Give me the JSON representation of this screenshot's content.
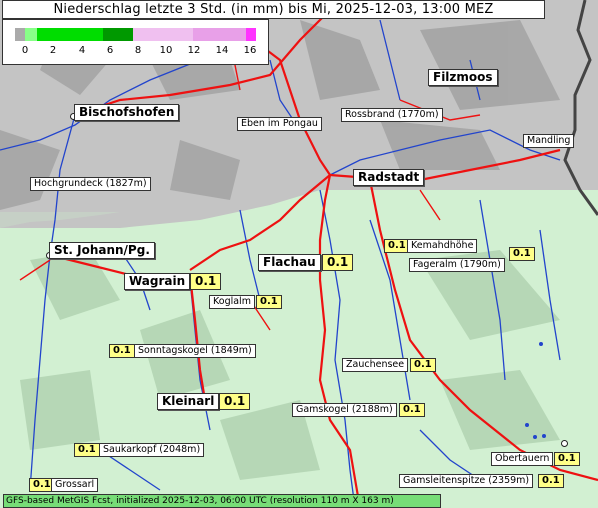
{
  "title": "Niederschlag letzte 3 Std. (in mm) bis Mi, 2025-12-03, 13:00 MEZ",
  "legend": {
    "ticks": [
      "0",
      "2",
      "4",
      "6",
      "8",
      "10",
      "12",
      "14",
      "16"
    ],
    "colors": [
      "#aaaaaa",
      "#88ff88",
      "#00dd00",
      "#00aa00",
      "#008800",
      "#f0c0f0",
      "#e8a0e8",
      "#e070e0",
      "#ff33ff"
    ]
  },
  "cities": [
    {
      "name": "Bischofshofen"
    },
    {
      "name": "Radstadt"
    },
    {
      "name": "Filzmoos"
    },
    {
      "name": "St. Johann/Pg."
    },
    {
      "name": "Wagrain",
      "value": "0.1"
    },
    {
      "name": "Flachau",
      "value": "0.1"
    },
    {
      "name": "Kleinarl",
      "value": "0.1"
    }
  ],
  "points": [
    {
      "name": "Eben im Pongau"
    },
    {
      "name": "Rossbrand (1770m)"
    },
    {
      "name": "Mandling"
    },
    {
      "name": "Hochgrundeck (1827m)"
    },
    {
      "name": "Kemahdhöhe",
      "value": "0.1"
    },
    {
      "name": "Fageralm (1790m)",
      "value": "0.1"
    },
    {
      "name": "Koglalm",
      "value": "0.1"
    },
    {
      "name": "Sonntagskogel (1849m)",
      "value": "0.1"
    },
    {
      "name": "Zauchensee",
      "value": "0.1"
    },
    {
      "name": "Gamskogel (2188m)",
      "value": "0.1"
    },
    {
      "name": "Saukarkopf (2048m)",
      "value": "0.1"
    },
    {
      "name": "Obertauern",
      "value": "0.1"
    },
    {
      "name": "Gamsleitenspitze (2359m)",
      "value": "0.1"
    },
    {
      "name": "Grossarl",
      "value": "0.1"
    }
  ],
  "footer": "GFS-based MetGIS Fcst, initialized 2025-12-03, 06:00 UTC  (resolution 110 m X 163 m)"
}
